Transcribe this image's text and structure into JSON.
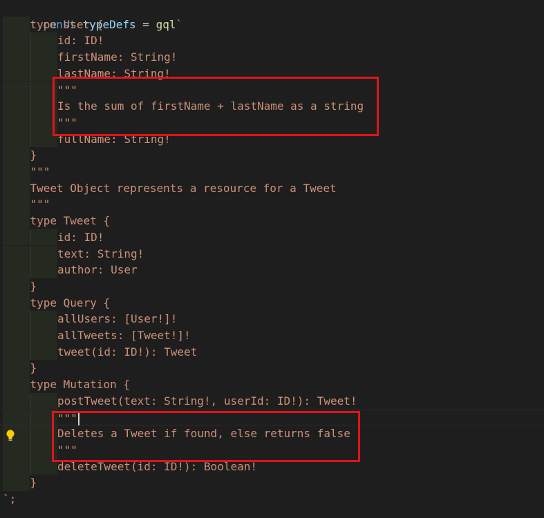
{
  "editor": {
    "line1": {
      "kw": "const",
      "ident": "typeDefs",
      "op": " = ",
      "fn": "gql",
      "tick": "`"
    },
    "lines": [
      "type User {",
      "id: ID!",
      "firstName: String!",
      "lastName: String!",
      "\"\"\"",
      "Is the sum of firstName + lastName as a string",
      "\"\"\"",
      "fullName: String!",
      "}",
      "\"\"\"",
      "Tweet Object represents a resource for a Tweet",
      "\"\"\"",
      "type Tweet {",
      "id: ID!",
      "text: String!",
      "author: User",
      "}",
      "type Query {",
      "allUsers: [User!]!",
      "allTweets: [Tweet!]!",
      "tweet(id: ID!): Tweet",
      "}",
      "type Mutation {",
      "postTweet(text: String!, userId: ID!): Tweet!",
      "\"\"\"",
      "Deletes a Tweet if found, else returns false",
      "\"\"\"",
      "deleteTweet(id: ID!): Boolean!",
      "}",
      "`;"
    ]
  },
  "colors": {
    "keyword": "#569cd6",
    "identifier": "#9cdcfe",
    "function": "#dcdcaa",
    "template_string": "#ce9178",
    "highlight_box": "#e0141b",
    "lightbulb": "#ffcc00"
  },
  "icons": {
    "lightbulb": "lightbulb-icon"
  }
}
